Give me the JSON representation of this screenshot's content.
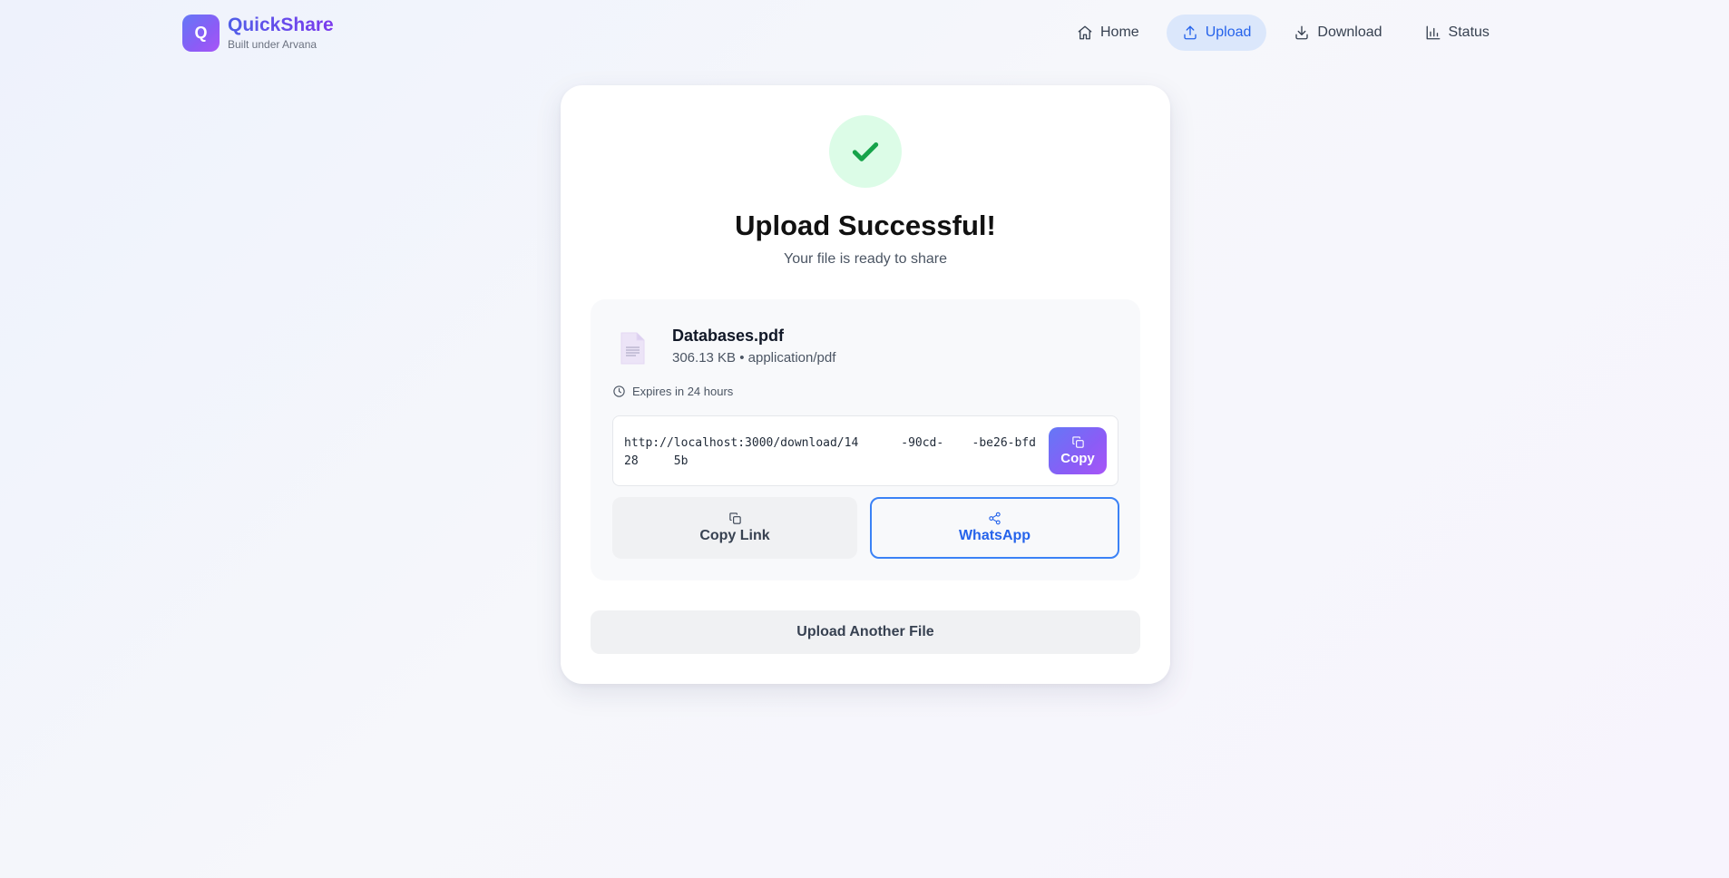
{
  "brand": {
    "logo_letter": "Q",
    "name": "QuickShare",
    "subtitle": "Built under Arvana"
  },
  "nav": {
    "items": [
      {
        "label": "Home",
        "icon": "home-icon",
        "active": false
      },
      {
        "label": "Upload",
        "icon": "upload-icon",
        "active": true
      },
      {
        "label": "Download",
        "icon": "download-icon",
        "active": false
      },
      {
        "label": "Status",
        "icon": "bar-chart-icon",
        "active": false
      }
    ],
    "active_color": "#2563eb"
  },
  "result": {
    "title": "Upload Successful!",
    "subtitle": "Your file is ready to share",
    "status_color": "#16a34a"
  },
  "file": {
    "name": "Databases.pdf",
    "meta": "306.13 KB • application/pdf",
    "expires": "Expires in 24 hours",
    "link": "http://localhost:3000/download/14      -90cd-    -be26-bfd28     5b"
  },
  "actions": {
    "copy_label": "Copy",
    "copy_link_label": "Copy Link",
    "whatsapp_label": "WhatsApp",
    "upload_another_label": "Upload Another File"
  },
  "colors": {
    "accent_start": "#6478f6",
    "accent_end": "#a855f7",
    "success_bg": "#dcfce7"
  }
}
